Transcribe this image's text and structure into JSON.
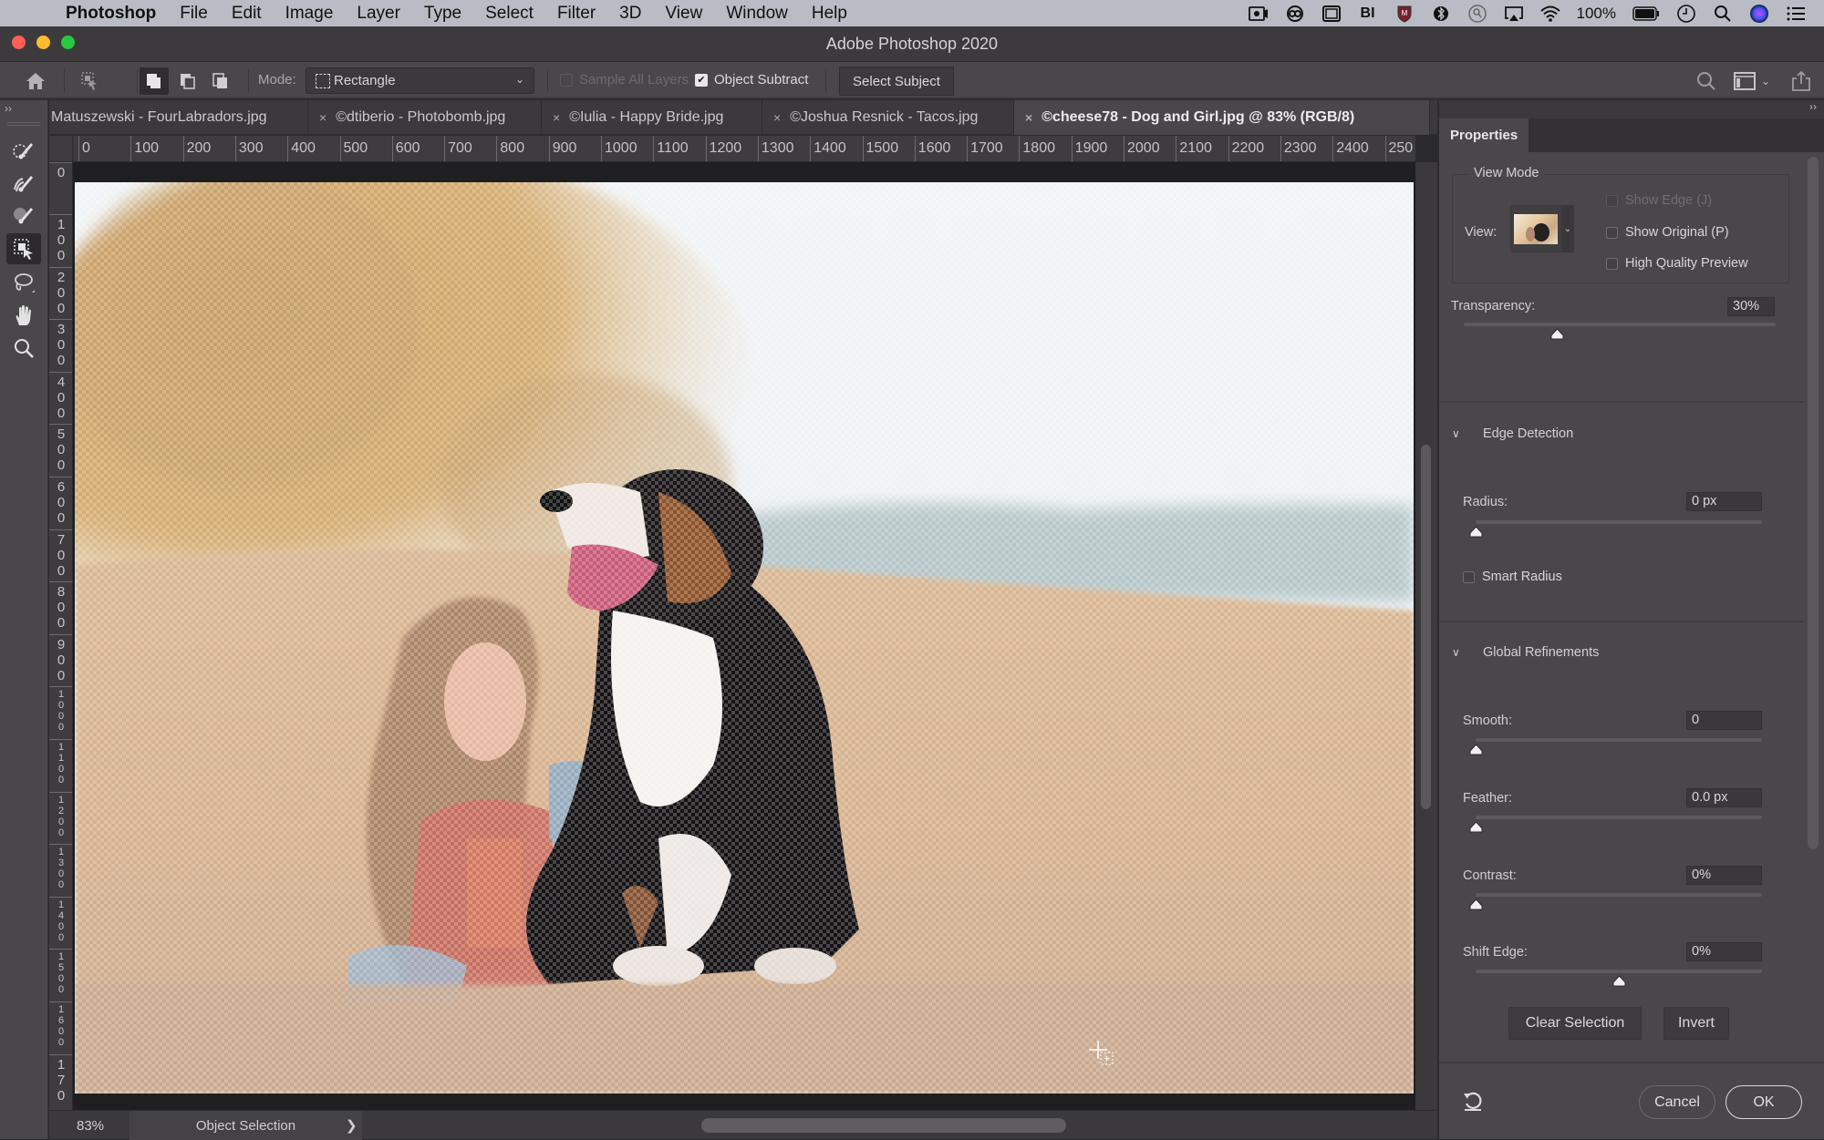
{
  "menubar": {
    "app_name": "Photoshop",
    "items": [
      "File",
      "Edit",
      "Image",
      "Layer",
      "Type",
      "Select",
      "Filter",
      "3D",
      "View",
      "Window",
      "Help"
    ],
    "status_icons": [
      "screen-record-icon",
      "creative-cloud-icon",
      "display-icon",
      "bi-icon",
      "mcafee-shield-icon",
      "bluetooth-icon",
      "spotlight-alt-icon",
      "airplay-icon",
      "wifi-icon"
    ],
    "battery_percent": "100%",
    "trailing_icons": [
      "clock-icon",
      "search-icon",
      "siri-icon",
      "control-center-icon"
    ]
  },
  "window": {
    "title": "Adobe Photoshop 2020",
    "traffic_light_colors": {
      "close": "#ff5f57",
      "minimize": "#febc2e",
      "zoom": "#28c840"
    }
  },
  "options_bar": {
    "mode_label": "Mode:",
    "mode_value": "Rectangle",
    "sample_all_layers_label": "Sample All Layers",
    "sample_all_layers_checked": false,
    "object_subtract_label": "Object Subtract",
    "object_subtract_checked": true,
    "select_subject_label": "Select Subject"
  },
  "doc_tabs": [
    {
      "label": "Matuszewski - FourLabradors.jpg",
      "active": false
    },
    {
      "label": "©dtiberio - Photobomb.jpg",
      "active": false
    },
    {
      "label": "©Iulia - Happy Bride.jpg",
      "active": false
    },
    {
      "label": "©Joshua Resnick - Tacos.jpg",
      "active": false
    },
    {
      "label": "©cheese78 - Dog and Girl.jpg @ 83% (RGB/8)",
      "active": true
    }
  ],
  "rulers": {
    "horizontal": [
      "0",
      "100",
      "200",
      "300",
      "400",
      "500",
      "600",
      "700",
      "800",
      "900",
      "1000",
      "1100",
      "1200",
      "1300",
      "1400",
      "1500",
      "1600",
      "1700",
      "1800",
      "1900",
      "2000",
      "2100",
      "2200",
      "2300",
      "2400",
      "250"
    ],
    "vertical": [
      "0",
      "100",
      "200",
      "300",
      "400",
      "500",
      "600",
      "700",
      "800",
      "900",
      "1000",
      "1100",
      "1200",
      "1300",
      "1400",
      "1500",
      "1600",
      "170"
    ]
  },
  "tools": [
    {
      "name": "quick-selection-brush",
      "active": false
    },
    {
      "name": "refine-edge-brush",
      "active": false
    },
    {
      "name": "brush",
      "active": false
    },
    {
      "name": "object-selection",
      "active": true
    },
    {
      "name": "lasso",
      "active": false
    },
    {
      "name": "hand",
      "active": false
    },
    {
      "name": "zoom",
      "active": false
    }
  ],
  "status_bar": {
    "zoom": "83%",
    "info": "Object Selection",
    "arrow": "❯"
  },
  "properties": {
    "panel_title": "Properties",
    "view_mode": {
      "heading": "View Mode",
      "view_label": "View:",
      "show_edge_label": "Show Edge (J)",
      "show_edge_checked": false,
      "show_edge_disabled": true,
      "show_original_label": "Show Original (P)",
      "show_original_checked": false,
      "high_quality_label": "High Quality Preview",
      "high_quality_checked": false
    },
    "transparency": {
      "label": "Transparency:",
      "value": "30%",
      "fraction": 0.3
    },
    "edge_detection": {
      "heading": "Edge Detection",
      "radius": {
        "label": "Radius:",
        "value": "0 px",
        "fraction": 0.0
      },
      "smart_radius_label": "Smart Radius",
      "smart_radius_checked": false
    },
    "global_refinements": {
      "heading": "Global Refinements",
      "smooth": {
        "label": "Smooth:",
        "value": "0",
        "fraction": 0.0
      },
      "feather": {
        "label": "Feather:",
        "value": "0.0 px",
        "fraction": 0.0
      },
      "contrast": {
        "label": "Contrast:",
        "value": "0%",
        "fraction": 0.0
      },
      "shift_edge": {
        "label": "Shift Edge:",
        "value": "0%",
        "fraction": 0.5
      }
    },
    "buttons": {
      "clear_selection": "Clear Selection",
      "invert": "Invert",
      "cancel": "Cancel",
      "ok": "OK"
    }
  }
}
